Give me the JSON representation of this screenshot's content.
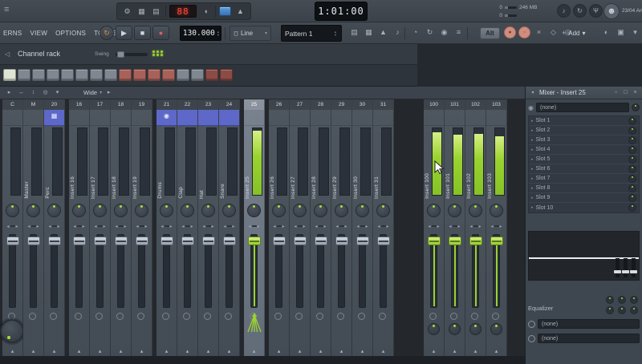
{
  "colors": {
    "accent_green": "#9ad32f",
    "track_blue": "#5e68c8",
    "led_red": "#ff4a38",
    "salmon": "#d08d7d"
  },
  "top": {
    "menus": [
      "ERNS",
      "VIEW",
      "OPTIONS",
      "TOOLS",
      "?"
    ],
    "hint_led": "88",
    "time": "1:01:00",
    "tempo": "130.000",
    "snap": "Line",
    "pattern": "Pattern 1",
    "cpu_value": "0",
    "cpu_value2": "0",
    "mem_value": "246 MB",
    "date": "23/04",
    "user": "Ann",
    "alt": "Alt",
    "add": "Add",
    "row1_icons_a": [
      {
        "name": "tools-icon",
        "glyph": "⚙"
      },
      {
        "name": "panel-grid-icon",
        "glyph": "▦"
      },
      {
        "name": "panel-layout-icon",
        "glyph": "▤"
      }
    ],
    "row1_icons_b": [
      {
        "name": "speaker-icon",
        "glyph": "◖"
      }
    ],
    "row1_icons_c": [
      {
        "name": "metronome-icon",
        "glyph": "▲"
      }
    ],
    "right_circle_icons": [
      {
        "name": "typing-piano-icon",
        "glyph": "♪"
      },
      {
        "name": "countdown-icon",
        "glyph": "↻"
      },
      {
        "name": "mic-icon",
        "glyph": "Ψ"
      },
      {
        "name": "monitor-icon",
        "glyph": "∩"
      }
    ],
    "transport": [
      {
        "name": "loop-record-button",
        "glyph": "↻",
        "color": "#e08a42",
        "cls": "round"
      },
      {
        "name": "play-button",
        "glyph": "▶",
        "color": "#cfd6dd"
      },
      {
        "name": "stop-button",
        "glyph": "■",
        "color": "#cfd6dd"
      },
      {
        "name": "record-button",
        "glyph": "●",
        "color": "#d9625a"
      }
    ],
    "toolbar_a": [
      {
        "name": "song-mode-icon",
        "glyph": "▤"
      },
      {
        "name": "step-grid-icon",
        "glyph": "▦"
      },
      {
        "name": "metronome-toggle-icon",
        "glyph": "▲"
      },
      {
        "name": "wait-input-icon",
        "glyph": "♪"
      }
    ],
    "toolbar_b": [
      {
        "name": "countdown-toggle-icon",
        "glyph": "◔"
      },
      {
        "name": "loop-toggle-icon",
        "glyph": "↻"
      },
      {
        "name": "overdub-icon",
        "glyph": "◉"
      },
      {
        "name": "step-edit-icon",
        "glyph": "≡"
      }
    ],
    "toolbar_c": [
      {
        "name": "playlist-icon",
        "glyph": "▥"
      },
      {
        "name": "piano-roll-icon",
        "glyph": "▦"
      },
      {
        "name": "mixer-open-icon",
        "glyph": "▮"
      }
    ],
    "salmon_buttons": [
      {
        "name": "touch-mode-button",
        "glyph": "●",
        "cls": "salmon"
      },
      {
        "name": "multilink-button",
        "glyph": "◦",
        "cls": "salmon"
      }
    ],
    "toolbar_d": [
      {
        "name": "cut-tool-icon",
        "glyph": "×"
      },
      {
        "name": "mute-tool-icon",
        "glyph": "◇"
      },
      {
        "name": "zoom-tool-icon",
        "glyph": "◎"
      }
    ],
    "toolbar_e": [
      {
        "name": "playback-tool-icon",
        "glyph": "◐"
      },
      {
        "name": "misc-tool-icon",
        "glyph": "▣"
      },
      {
        "name": "more-tools-icon",
        "glyph": "▾"
      }
    ]
  },
  "rack": {
    "title": "Channel rack",
    "swing": "Swing",
    "buttons": [
      "#dde4d4",
      "#7f8791",
      "#7f8791",
      "#7f8791",
      "#7f8791",
      "#7f8791",
      "#7f8791",
      "#7f8791",
      "#a86159",
      "#a86159",
      "#a86159",
      "#a86159",
      "#7f8791",
      "#7f8791",
      "#8d4b45",
      "#8d4b45"
    ]
  },
  "mixer": {
    "view_mode": "Wide",
    "toolbar_icons": [
      {
        "name": "mixer-menu-icon",
        "glyph": "▸"
      },
      {
        "name": "link-icon",
        "glyph": "↔"
      },
      {
        "name": "sort-icon",
        "glyph": "↕"
      },
      {
        "name": "target-icon",
        "glyph": "◎"
      },
      {
        "name": "dock-icon",
        "glyph": "▾"
      }
    ],
    "groups": [
      {
        "tracks": [
          {
            "num": "C",
            "name": "",
            "big_knob": true
          },
          {
            "num": "M",
            "name": "Master"
          },
          {
            "num": "20",
            "name": "Perc",
            "color": "blue",
            "icon": "send-icon"
          }
        ]
      },
      {
        "tracks": [
          {
            "num": "16",
            "name": "Insert 16"
          },
          {
            "num": "17",
            "name": "Insert 17"
          },
          {
            "num": "18",
            "name": "Insert 18"
          },
          {
            "num": "19",
            "name": "Insert 19"
          }
        ]
      },
      {
        "tracks": [
          {
            "num": "21",
            "name": "Drums",
            "color": "blue",
            "icon": "drums-icon"
          },
          {
            "num": "22",
            "name": "Clap",
            "color": "blue"
          },
          {
            "num": "23",
            "name": "Hat",
            "color": "blue"
          },
          {
            "num": "24",
            "name": "Snare",
            "color": "blue"
          }
        ]
      },
      {
        "tracks": [
          {
            "num": "25",
            "name": "Insert 25",
            "selected": true,
            "meter": 0.97,
            "fader": "green",
            "fan": true
          }
        ]
      },
      {
        "tracks": [
          {
            "num": "26",
            "name": "Insert 26"
          },
          {
            "num": "27",
            "name": "Insert 27"
          },
          {
            "num": "28",
            "name": "Insert 28"
          },
          {
            "num": "29",
            "name": "Insert 29"
          },
          {
            "num": "30",
            "name": "Insert 30"
          },
          {
            "num": "31",
            "name": "Insert 31"
          }
        ]
      },
      {
        "gap": 32,
        "tracks": [
          {
            "num": "100",
            "name": "Insert 100",
            "meter": 0.94,
            "fader": "green",
            "knob": true
          },
          {
            "num": "101",
            "name": "Insert 101",
            "meter": 0.9,
            "fader": "green",
            "knob": true
          },
          {
            "num": "102",
            "name": "Insert 102",
            "meter": 0.92,
            "fader": "green",
            "knob": true
          },
          {
            "num": "103",
            "name": "Insert 103",
            "meter": 0.88,
            "fader": "green",
            "knob": true
          }
        ]
      }
    ],
    "panel": {
      "title": "Mixer - Insert 25",
      "window_icons": [
        {
          "name": "detach-icon",
          "glyph": "▫"
        },
        {
          "name": "maximize-icon",
          "glyph": "□"
        },
        {
          "name": "close-icon",
          "glyph": "×"
        }
      ],
      "routing_value": "(none)",
      "slots": [
        "Slot 1",
        "Slot 2",
        "Slot 3",
        "Slot 4",
        "Slot 5",
        "Slot 6",
        "Slot 7",
        "Slot 8",
        "Slot 9",
        "Slot 10"
      ],
      "equalizer": "Equalizer",
      "send1": "(none)",
      "send2": "(none)"
    }
  }
}
